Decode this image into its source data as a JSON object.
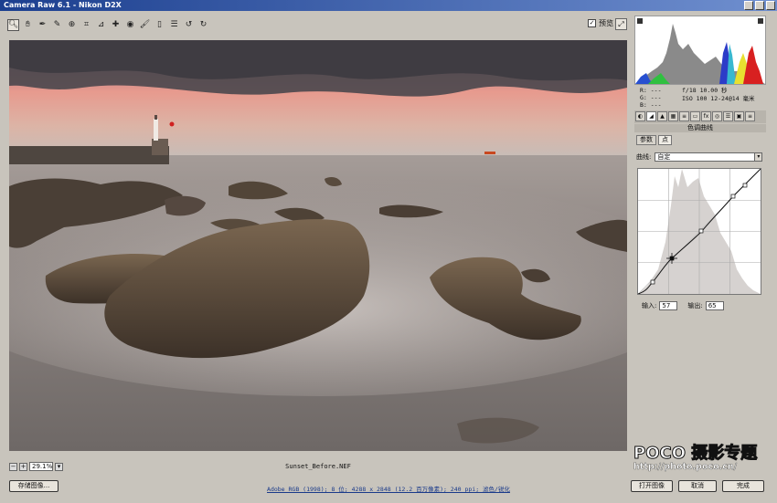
{
  "window": {
    "title": "Camera Raw 6.1 -  Nikon D2X"
  },
  "toolbar": {
    "tools": [
      "zoom-icon",
      "hand-icon",
      "white-balance-icon",
      "color-sampler-icon",
      "target-adjust-icon",
      "crop-icon",
      "straighten-icon",
      "spot-removal-icon",
      "red-eye-icon",
      "adjustment-brush-icon",
      "graduated-filter-icon",
      "preferences-icon",
      "rotate-ccw-icon",
      "rotate-cw-icon"
    ],
    "preview_label": "预览"
  },
  "histogram": {
    "rgb_labels": [
      "R:  ---",
      "G:  ---",
      "B:  ---"
    ],
    "exif": [
      "f/18   10.00 秒",
      "ISO 100   12-24@14 毫米"
    ]
  },
  "panel": {
    "section_title": "色调曲线",
    "subtabs": [
      "参数",
      "点"
    ],
    "curve_label": "曲线:",
    "curve_value": "自定",
    "input_label": "输入:",
    "input_value": "57",
    "output_label": "输出:",
    "output_value": "65"
  },
  "canvas": {
    "filename": "Sunset_Before.NEF",
    "zoom": "29.1%"
  },
  "footer": {
    "save_label": "存储图像...",
    "workflow": "Adobe RGB (1998); 8 位; 4288 x 2848 (12.2 百万像素); 240 ppi; 滤色/锐化",
    "open_label": "打开图像",
    "cancel_label": "取消",
    "done_label": "完成"
  },
  "watermark": {
    "brand": "POCO 摄影专题",
    "url": "http://photo.poco.cn/"
  }
}
